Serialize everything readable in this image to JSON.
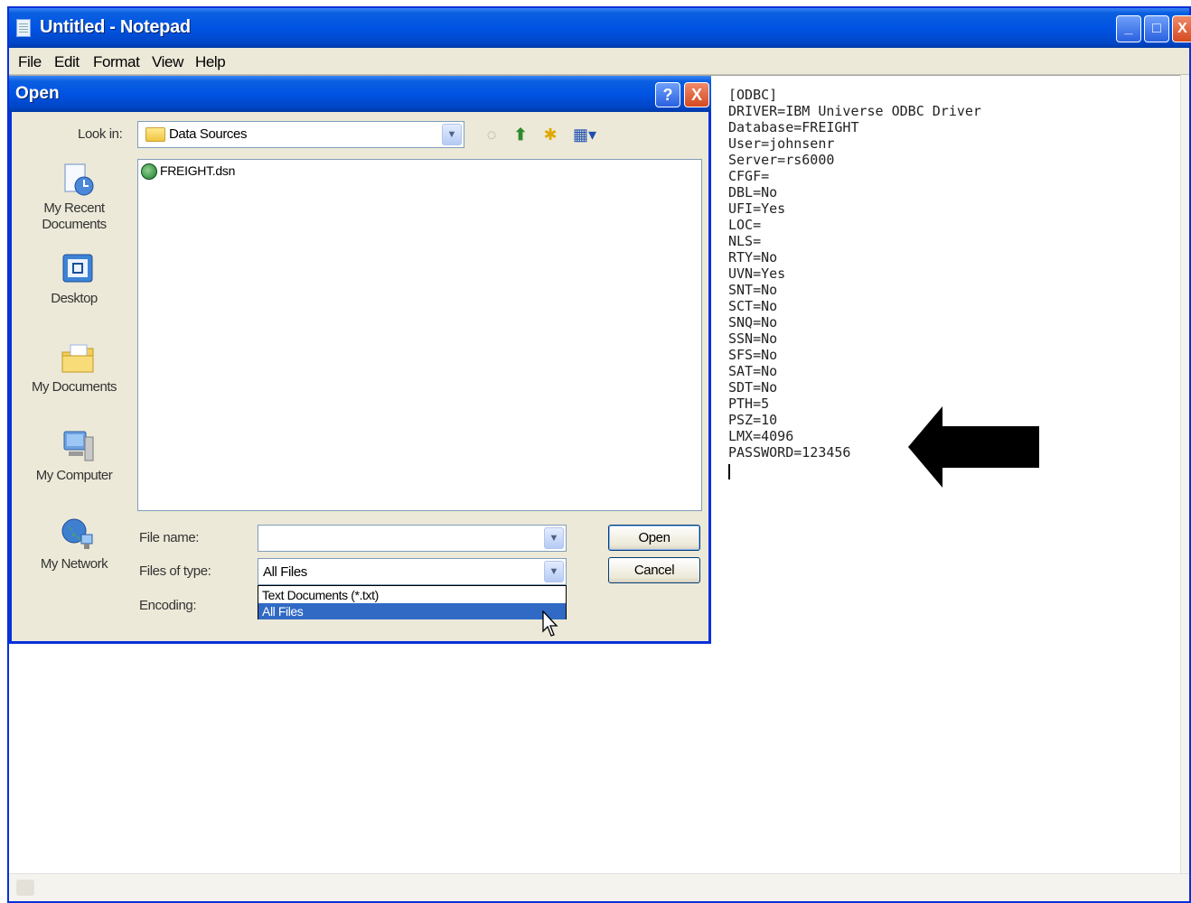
{
  "notepad": {
    "title": "Untitled - Notepad",
    "menu": [
      "File",
      "Edit",
      "Format",
      "View",
      "Help"
    ],
    "controls": {
      "minimize": "_",
      "maximize": "□",
      "close": "X"
    },
    "content": "[ODBC]\nDRIVER=IBM Universe ODBC Driver\nDatabase=FREIGHT\nUser=johnsenr\nServer=rs6000\nCFGF=\nDBL=No\nUFI=Yes\nLOC=\nNLS=\nRTY=No\nUVN=Yes\nSNT=No\nSCT=No\nSNQ=No\nSSN=No\nSFS=No\nSAT=No\nSDT=No\nPTH=5\nPSZ=10\nLMX=4096\nPASSWORD=123456"
  },
  "dialog": {
    "title": "Open",
    "help": "?",
    "close": "X",
    "look_in_label": "Look in:",
    "look_in_value": "Data Sources",
    "places": [
      "My Recent\nDocuments",
      "Desktop",
      "My Documents",
      "My Computer",
      "My Network"
    ],
    "files": [
      "FREIGHT.dsn"
    ],
    "file_name_label": "File name:",
    "file_name_value": "",
    "files_of_type_label": "Files of type:",
    "files_of_type_value": "All Files",
    "files_of_type_options": [
      "Text Documents (*.txt)",
      "All Files"
    ],
    "encoding_label": "Encoding:",
    "open_button": "Open",
    "cancel_button": "Cancel"
  },
  "icons": {
    "dropdown_arrow": "▼",
    "back": "◌",
    "up": "⬆",
    "new_folder": "✱",
    "views": "▦▾"
  }
}
